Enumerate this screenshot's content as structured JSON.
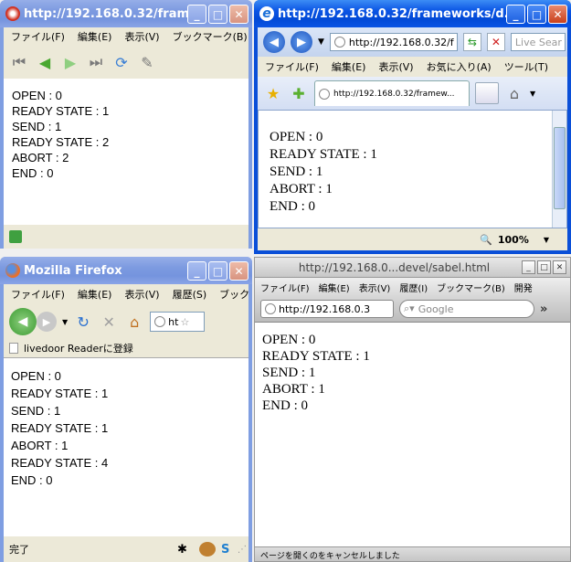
{
  "sleipnir": {
    "title": "http://192.168.0.32/fram...",
    "menu": [
      "ファイル(F)",
      "編集(E)",
      "表示(V)",
      "ブックマーク(B)"
    ],
    "lines": [
      "OPEN : 0",
      "READY STATE : 1",
      "SEND : 1",
      "READY STATE : 2",
      "ABORT : 2",
      "END : 0"
    ]
  },
  "ie": {
    "title": "http://192.168.0.32/frameworks/d...",
    "address": "http://192.168.0.32/f",
    "search_placeholder": "Live Sear",
    "menu": [
      "ファイル(F)",
      "編集(E)",
      "表示(V)",
      "お気に入り(A)",
      "ツール(T)"
    ],
    "tab_title": "http://192.168.0.32/framew...",
    "lines": [
      "OPEN : 0",
      "READY STATE : 1",
      "SEND : 1",
      "ABORT : 1",
      "END : 0"
    ],
    "zoom": "100%"
  },
  "firefox": {
    "title": "Mozilla Firefox",
    "menu": [
      "ファイル(F)",
      "編集(E)",
      "表示(V)",
      "履歴(S)",
      "ブックマ"
    ],
    "address": "ht",
    "bookmark": "livedoor Readerに登録",
    "lines": [
      "OPEN : 0",
      "READY STATE : 1",
      "SEND : 1",
      "READY STATE : 1",
      "ABORT : 1",
      "READY STATE : 4",
      "END : 0"
    ],
    "status": "完了"
  },
  "sabel": {
    "title": "http://192.168.0...devel/sabel.html",
    "menu": [
      "ファイル(F)",
      "編集(E)",
      "表示(V)",
      "履歴(I)",
      "ブックマーク(B)",
      "開発"
    ],
    "address": "http://192.168.0.3",
    "search_placeholder": "Google",
    "lines": [
      "OPEN : 0",
      "READY STATE : 1",
      "SEND : 1",
      "ABORT : 1",
      "END : 0"
    ],
    "status": "ページを開くのをキャンセルしました"
  }
}
